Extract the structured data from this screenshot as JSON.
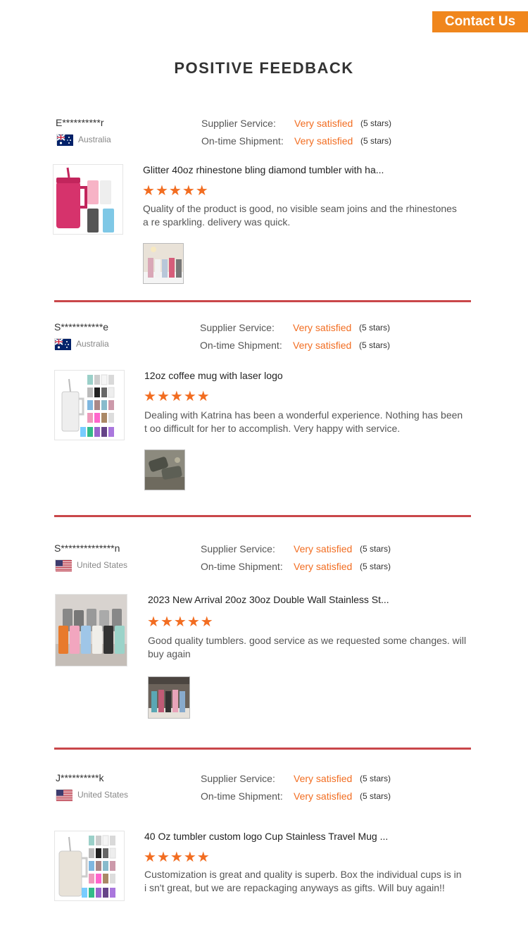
{
  "header": {
    "contact_label": "Contact Us",
    "title": "POSITIVE FEEDBACK"
  },
  "labels": {
    "supplier_service": "Supplier Service:",
    "on_time_shipment": "On-time Shipment:",
    "satisfied": "Very satisfied",
    "five_stars": "(5 stars)"
  },
  "reviews": [
    {
      "user": "E**********r",
      "country": "Australia",
      "product": "Glitter 40oz rhinestone bling diamond tumbler with ha...",
      "comment": "Quality of the product is good, no visible seam joins and the rhinestones a re sparkling. delivery was quick.",
      "stars": 5
    },
    {
      "user": "S***********e",
      "country": "Australia",
      "product": "12oz coffee mug with laser logo",
      "comment": "Dealing with Katrina has been a wonderful experience. Nothing has been t oo difficult for her to accomplish. Very happy with service.",
      "stars": 5
    },
    {
      "user": "S**************n",
      "country": "United States",
      "product": "2023 New Arrival 20oz 30oz Double Wall Stainless St...",
      "comment": "Good quality tumblers. good service as we requested some changes. will buy again",
      "stars": 5
    },
    {
      "user": "J**********k",
      "country": "United States",
      "product": "40 Oz tumbler custom logo Cup Stainless Travel Mug ...",
      "comment": "Customization is great and quality is superb. Box the individual cups is in i sn't great, but we are repackaging anyways as gifts. Will buy again!!",
      "stars": 5
    }
  ],
  "colors": {
    "accent": "#f26d21",
    "contact_bg": "#f0861c",
    "divider": "#c9474a"
  }
}
